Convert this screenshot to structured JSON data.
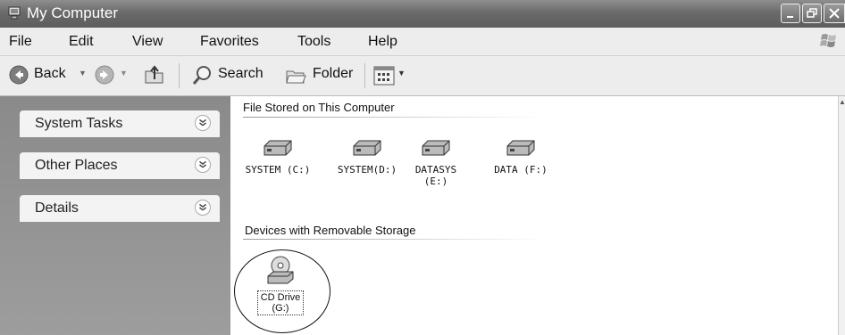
{
  "window": {
    "title": "My Computer"
  },
  "menu": [
    "File",
    "Edit",
    "View",
    "Favorites",
    "Tools",
    "Help"
  ],
  "toolbar": {
    "back_label": "Back",
    "search_label": "Search",
    "folder_label": "Folder"
  },
  "tasks": [
    "System Tasks",
    "Other Places",
    "Details"
  ],
  "groups": {
    "fixed": "File Stored on This Computer",
    "removable": "Devices with Removable Storage"
  },
  "drives": [
    {
      "label": "SYSTEM (C:)"
    },
    {
      "label": "SYSTEM(D:)"
    },
    {
      "label": "DATASYS (E:)"
    },
    {
      "label": "DATA (F:)"
    }
  ],
  "removable": [
    {
      "label_line1": "CD Drive",
      "label_line2": "(G:)"
    }
  ],
  "icons": {
    "app": "my-computer-icon",
    "back": "back-arrow-icon",
    "forward": "forward-arrow-icon",
    "up": "up-folder-icon",
    "search": "search-icon",
    "folder": "folders-icon",
    "views": "views-icon",
    "drive": "hard-drive-icon",
    "cd": "cd-drive-icon",
    "chevron": "expand-chevron-icon"
  }
}
